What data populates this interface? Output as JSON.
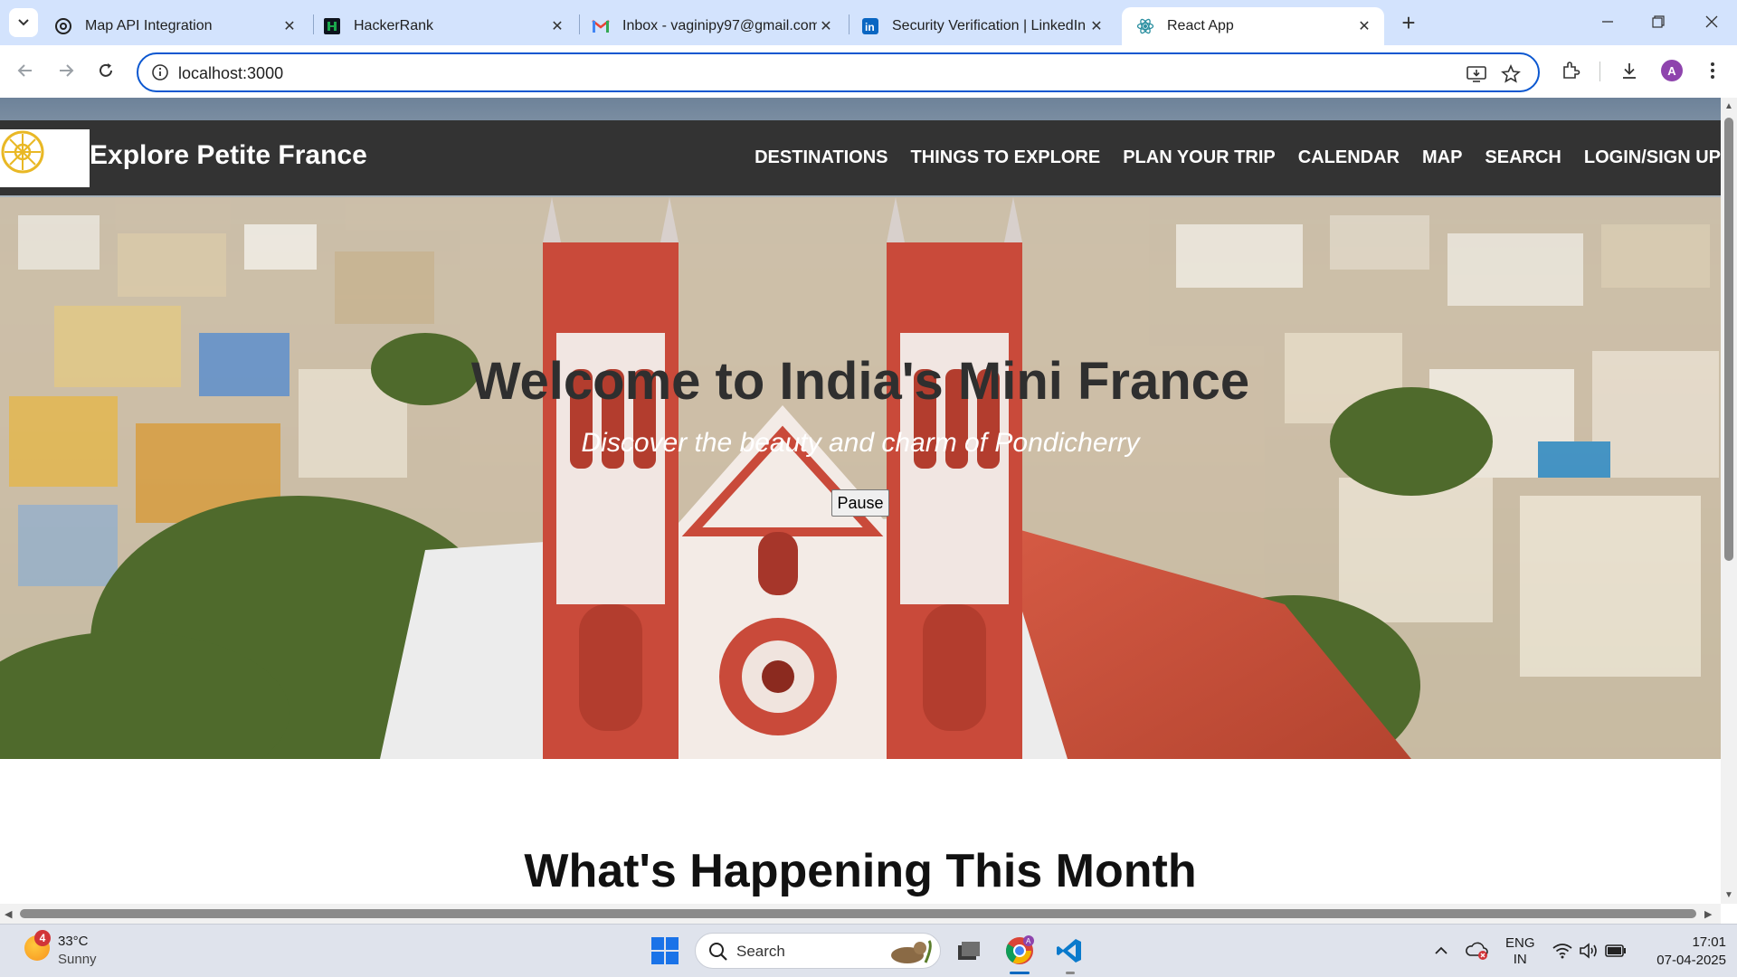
{
  "browser": {
    "tabs": [
      {
        "title": "Map API Integration",
        "favicon": "openai-icon",
        "active": false
      },
      {
        "title": "HackerRank",
        "favicon": "hackerrank-icon",
        "active": false
      },
      {
        "title": "Inbox - vaginipy97@gmail.com",
        "favicon": "gmail-icon",
        "active": false
      },
      {
        "title": "Security Verification | LinkedIn",
        "favicon": "linkedin-icon",
        "active": false
      },
      {
        "title": "React App",
        "favicon": "react-icon",
        "active": true
      }
    ],
    "url": "localhost:3000",
    "profile_initial": "A"
  },
  "site": {
    "title": "Explore Petite France",
    "nav": [
      "DESTINATIONS",
      "THINGS TO EXPLORE",
      "PLAN YOUR TRIP",
      "CALENDAR",
      "MAP",
      "SEARCH",
      "LOGIN/SIGN UP"
    ],
    "hero": {
      "title": "Welcome to India's Mini France",
      "subtitle": "Discover the beauty and charm of Pondicherry",
      "pause_label": "Pause"
    },
    "section_title": "What's Happening This Month"
  },
  "taskbar": {
    "weather": {
      "badge": "4",
      "temp": "33°C",
      "condition": "Sunny"
    },
    "search_label": "Search",
    "language": {
      "line1": "ENG",
      "line2": "IN"
    },
    "clock": {
      "time": "17:01",
      "date": "07-04-2025"
    }
  },
  "colors": {
    "nav_bg": "#333333",
    "tab_strip": "#d3e3fd",
    "omnibox_border": "#0b57d0",
    "taskbar_bg": "#dfe3ec"
  }
}
